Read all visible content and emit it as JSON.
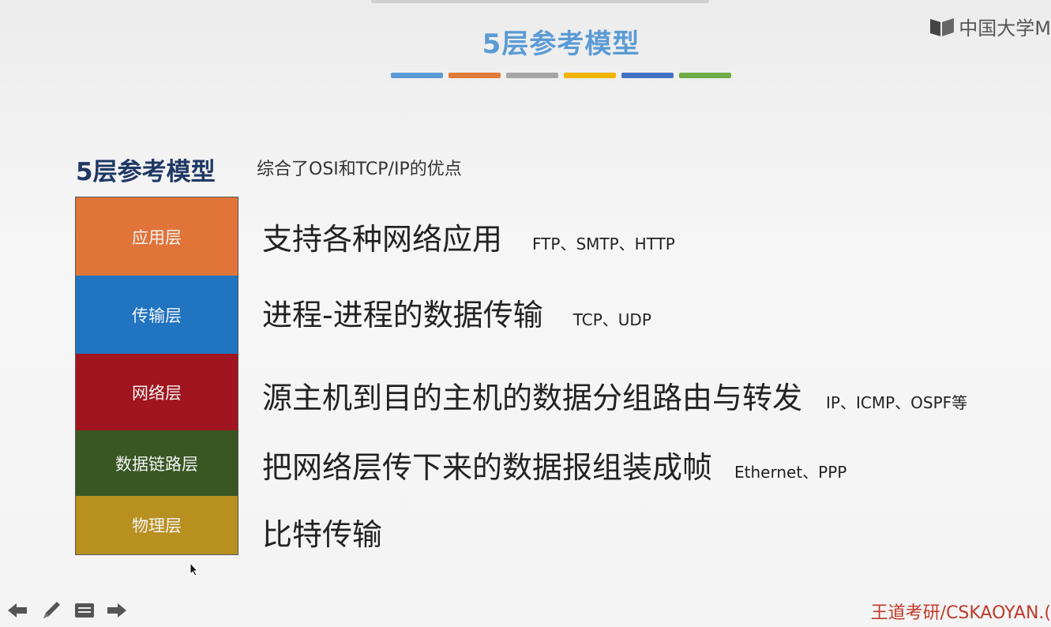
{
  "slide": {
    "title": "5层参考模型",
    "title_color": "#5b9bd5",
    "bar_colors": [
      "#5b9bd5",
      "#e07b39",
      "#a5a5a5",
      "#f0b400",
      "#4472c4",
      "#70ad47"
    ]
  },
  "logo": {
    "text": "中国大学M"
  },
  "heading": "5层参考模型",
  "subheading": "综合了OSI和TCP/IP的优点",
  "layers": [
    {
      "name": "应用层",
      "color": "#e07439",
      "desc": "支持各种网络应用",
      "protocols": "FTP、SMTP、HTTP"
    },
    {
      "name": "传输层",
      "color": "#2074c0",
      "desc": "进程-进程的数据传输",
      "protocols": "TCP、UDP"
    },
    {
      "name": "网络层",
      "color": "#a0151f",
      "desc": "源主机到目的主机的数据分组路由与转发",
      "protocols": "IP、ICMP、OSPF等"
    },
    {
      "name": "数据链路层",
      "color": "#385723",
      "desc": "把网络层传下来的数据报组装成帧",
      "protocols": "Ethernet、PPP"
    },
    {
      "name": "物理层",
      "color": "#b8901f",
      "desc": "比特传输",
      "protocols": ""
    }
  ],
  "nav_icons": [
    "arrow-left-icon",
    "pen-icon",
    "menu-icon",
    "arrow-right-icon"
  ],
  "watermark": "王道考研/CSKAOYAN.("
}
